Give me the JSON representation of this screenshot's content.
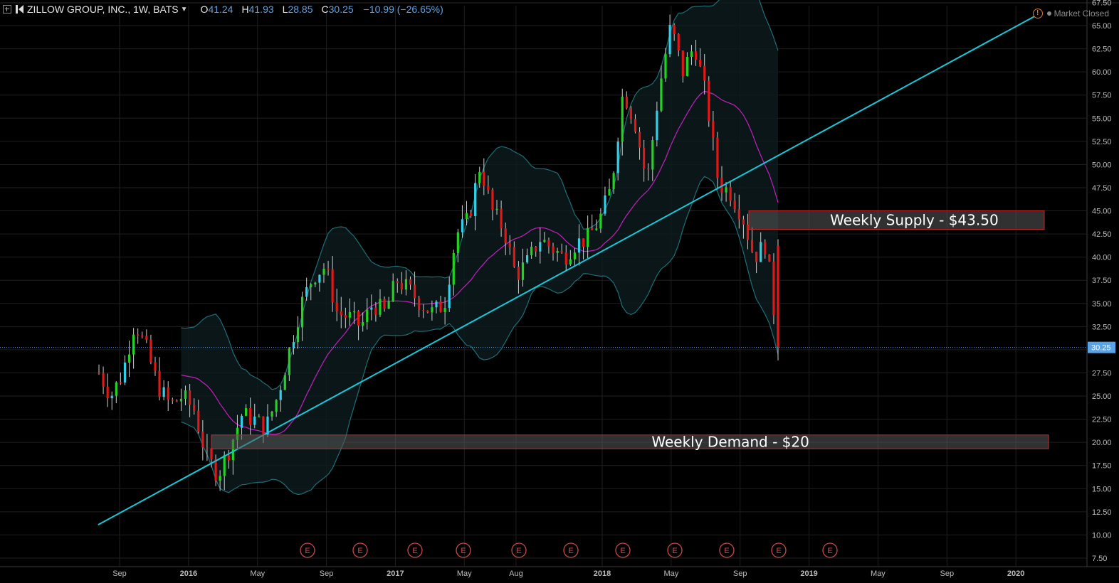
{
  "header": {
    "symbol": "ZILLOW GROUP, INC., 1W, BATS",
    "open_label": "O",
    "open": "41.24",
    "high_label": "H",
    "high": "41.93",
    "low_label": "L",
    "low": "28.85",
    "close_label": "C",
    "close": "30.25",
    "change": "−10.99 (−26.65%)"
  },
  "status": {
    "text": "Market Closed"
  },
  "colors": {
    "up": "#22d322",
    "down": "#e01818",
    "up_alt": "#2fd0e8",
    "trendline": "#16c8d8",
    "ma": "#c61fc0",
    "bands": "#1e6f78",
    "zone_border": "#c62828"
  },
  "chart_data": {
    "type": "candlestick",
    "title": "",
    "price_axis": {
      "ylim": [
        7.5,
        67.5
      ],
      "ticks": [
        "7.50",
        "10.00",
        "12.50",
        "15.00",
        "17.50",
        "20.00",
        "22.50",
        "25.00",
        "27.50",
        "30.00",
        "32.50",
        "35.00",
        "37.50",
        "40.00",
        "42.50",
        "45.00",
        "47.50",
        "50.00",
        "52.50",
        "55.00",
        "57.50",
        "60.00",
        "62.50",
        "65.00"
      ],
      "current_price_label": "30.25",
      "current_price": 30.25
    },
    "time_axis": {
      "labels": [
        "Sep",
        "2016",
        "May",
        "Sep",
        "2017",
        "May",
        "Aug",
        "2018",
        "May",
        "Sep",
        "2019",
        "May",
        "Sep",
        "2020"
      ],
      "bold": [
        "2016",
        "2017",
        "2018",
        "2019",
        "2020"
      ]
    },
    "earnings_marker_label": "E",
    "earnings_count": 11,
    "zones": [
      {
        "label": "Weekly Supply - $43.50",
        "price_low": 43.0,
        "price_high": 45.0
      },
      {
        "label": "Weekly Demand - $20",
        "price_low": 19.3,
        "price_high": 20.8
      }
    ],
    "trendline": {
      "from": {
        "date": "2015-08",
        "price": 11.1
      },
      "to": {
        "date": "2020-02",
        "price": 66.0
      }
    },
    "price_path": [
      27.5,
      25.0,
      27.5,
      33.0,
      30.0,
      26.0,
      24.0,
      25.0,
      23.5,
      18.5,
      16.5,
      19.5,
      23.0,
      22.5,
      21.5,
      25.0,
      30.0,
      35.0,
      38.0,
      39.0,
      34.0,
      33.5,
      32.5,
      35.0,
      34.0,
      37.5,
      36.5,
      35.0,
      34.0,
      35.0,
      42.5,
      44.0,
      50.0,
      45.0,
      43.0,
      38.0,
      39.5,
      42.0,
      41.0,
      40.0,
      41.5,
      42.0,
      44.0,
      47.5,
      58.0,
      54.5,
      48.0,
      58.0,
      65.0,
      60.0,
      63.0,
      57.0,
      48.0,
      47.0,
      44.5,
      40.0,
      41.5,
      30.25
    ]
  }
}
